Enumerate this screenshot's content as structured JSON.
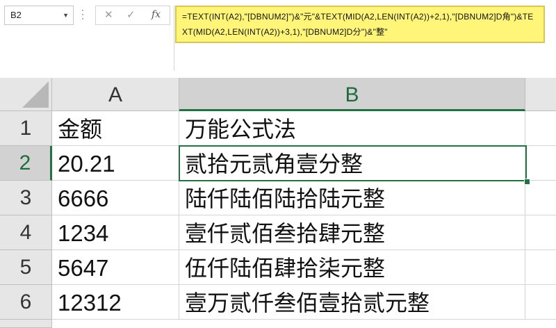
{
  "name_box": {
    "value": "B2"
  },
  "formula_bar": {
    "cancel_icon": "✕",
    "enter_icon": "✓",
    "fx_label": "fx",
    "formula": "=TEXT(INT(A2),\"[DBNUM2]\")&\"元\"&TEXT(MID(A2,LEN(INT(A2))+2,1),\"[DBNUM2]D角\")&TEXT(MID(A2,LEN(INT(A2))+3,1),\"[DBNUM2]D分\")&\"整\""
  },
  "columns": [
    "A",
    "B"
  ],
  "rows": [
    {
      "num": "1",
      "a": "金额",
      "b": "万能公式法"
    },
    {
      "num": "2",
      "a": "20.21",
      "b": "贰拾元贰角壹分整"
    },
    {
      "num": "3",
      "a": "6666",
      "b": "陆仟陆佰陆拾陆元整"
    },
    {
      "num": "4",
      "a": "1234",
      "b": "壹仟贰佰叁拾肆元整"
    },
    {
      "num": "5",
      "a": "5647",
      "b": "伍仟陆佰肆拾柒元整"
    },
    {
      "num": "6",
      "a": "12312",
      "b": "壹万贰仟叁佰壹拾贰元整"
    }
  ],
  "colors": {
    "accent": "#217346",
    "formula_highlight": "#fff579"
  }
}
